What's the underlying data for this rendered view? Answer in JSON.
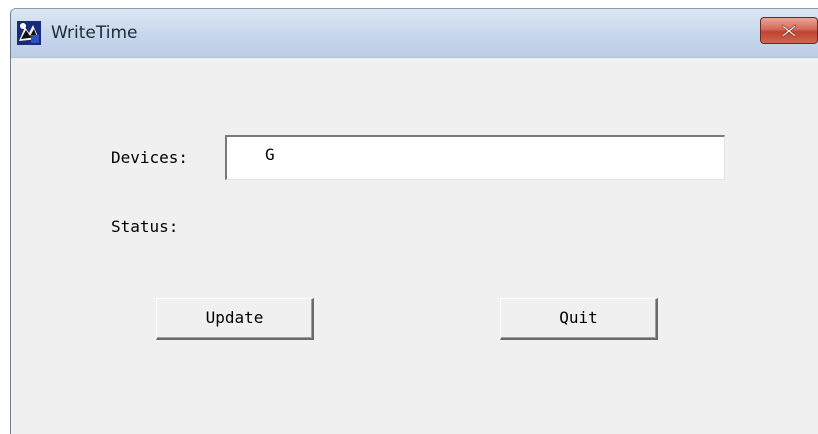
{
  "window": {
    "title": "WriteTime",
    "icon": "writetime-app-icon",
    "close_icon": "close-icon"
  },
  "form": {
    "devices_label": "Devices:",
    "devices_value": "G",
    "status_label": "Status:",
    "status_value": ""
  },
  "buttons": {
    "update_label": "Update",
    "quit_label": "Quit"
  },
  "colors": {
    "titlebar": "#c8d8ec",
    "close_button": "#c0442f",
    "client_background": "#f0f0f0"
  }
}
